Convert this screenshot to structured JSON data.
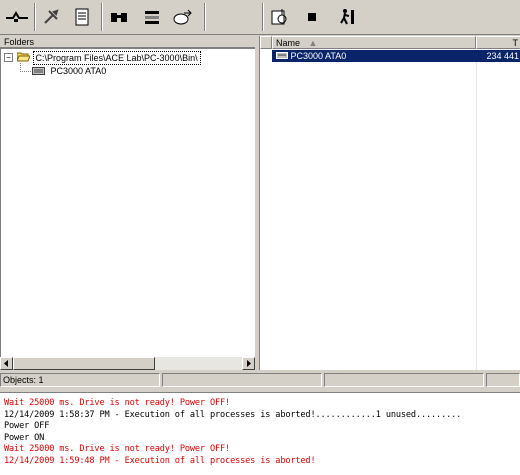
{
  "toolbar": {
    "buttons": [
      {
        "icon": "plug-icon"
      },
      {
        "icon": "tools-icon"
      },
      {
        "icon": "scroll-icon"
      },
      {
        "icon": "binoculars-icon"
      },
      {
        "icon": "scale-icon"
      },
      {
        "icon": "disk-export-icon"
      },
      {
        "icon": "disk-settings-icon"
      },
      {
        "icon": "stop-icon"
      },
      {
        "icon": "run-icon"
      }
    ]
  },
  "folders": {
    "header": "Folders",
    "root_label": "C:\\Program Files\\ACE Lab\\PC-3000\\Bin\\",
    "child_label": "PC3000 ATA0"
  },
  "file_list": {
    "columns": [
      "Name",
      "T"
    ],
    "rows": [
      {
        "name": "PC3000 ATA0",
        "size": "234 441"
      }
    ]
  },
  "status": {
    "objects": "Objects: 1"
  },
  "log": {
    "lines": [
      {
        "text": "Wait 25000 ms. Drive is not ready! Power OFF!",
        "color": "red"
      },
      {
        "text": "12/14/2009 1:58:37 PM - Execution of all processes is aborted!............1 unused.........",
        "color": "black"
      },
      {
        "text": "Power OFF",
        "color": "black"
      },
      {
        "text": "Power ON",
        "color": "black"
      },
      {
        "text": "Wait 25000 ms. Drive is not ready! Power OFF!",
        "color": "red"
      },
      {
        "text": "12/14/2009 1:59:48 PM - Execution of all processes is aborted!",
        "color": "red"
      }
    ]
  },
  "colors": {
    "selection": "#0a246a",
    "log_red": "#e00000",
    "face": "#d4d0c8"
  }
}
